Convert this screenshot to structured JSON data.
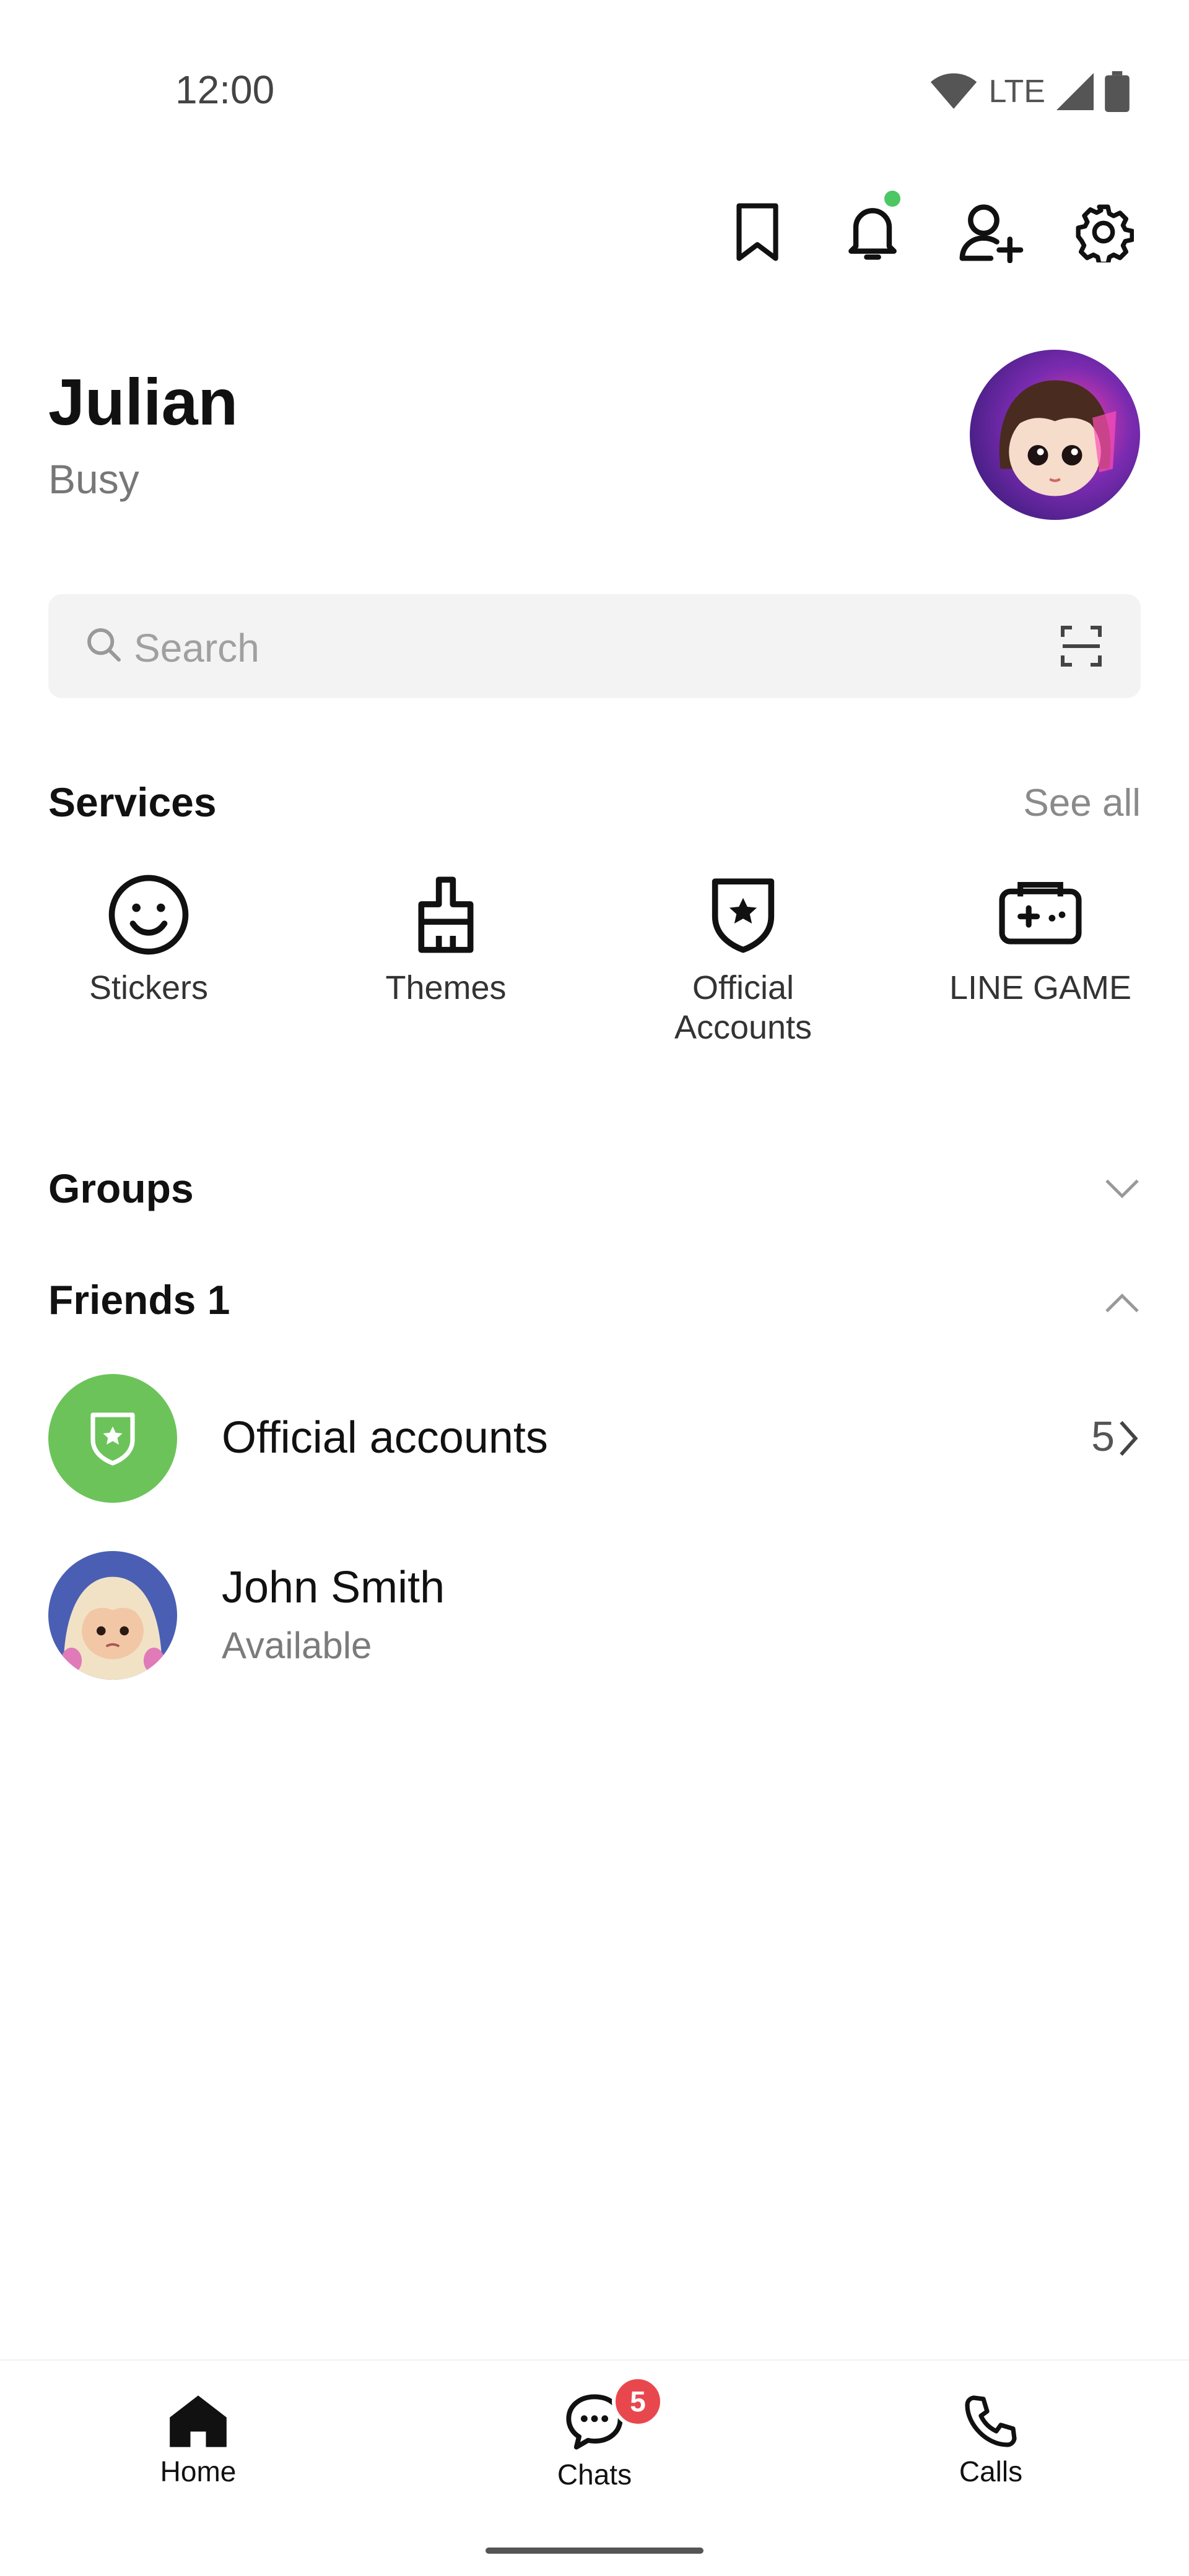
{
  "status_bar": {
    "time": "12:00",
    "network": "LTE"
  },
  "profile": {
    "name": "Julian",
    "status": "Busy"
  },
  "search": {
    "placeholder": "Search"
  },
  "services": {
    "title": "Services",
    "see_all": "See all",
    "items": [
      {
        "label": "Stickers",
        "icon": "smiley-icon"
      },
      {
        "label": "Themes",
        "icon": "brush-icon"
      },
      {
        "label": "Official\nAccounts",
        "icon": "shield-star-icon"
      },
      {
        "label": "LINE GAME",
        "icon": "gamepad-icon"
      }
    ]
  },
  "groups": {
    "title": "Groups"
  },
  "friends": {
    "title": "Friends",
    "count": "1",
    "official": {
      "label": "Official accounts",
      "count": "5"
    },
    "items": [
      {
        "name": "John Smith",
        "status": "Available"
      }
    ]
  },
  "bottom_nav": {
    "items": [
      {
        "label": "Home",
        "icon": "home-icon"
      },
      {
        "label": "Chats",
        "icon": "chat-bubble-icon",
        "badge": "5"
      },
      {
        "label": "Calls",
        "icon": "phone-icon"
      }
    ]
  },
  "colors": {
    "accent_green": "#4cc764",
    "badge_red": "#e8484d"
  }
}
